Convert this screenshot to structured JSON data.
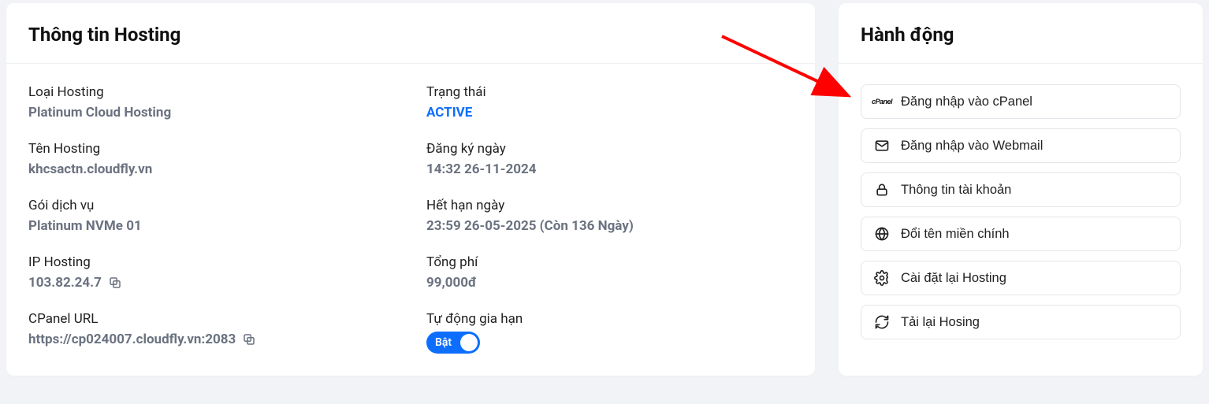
{
  "info_card": {
    "title": "Thông tin Hosting",
    "left": {
      "hosting_type_label": "Loại Hosting",
      "hosting_type_value": "Platinum Cloud Hosting",
      "hosting_name_label": "Tên Hosting",
      "hosting_name_value": "khcsactn.cloudfly.vn",
      "plan_label": "Gói dịch vụ",
      "plan_value": "Platinum NVMe 01",
      "ip_label": "IP Hosting",
      "ip_value": "103.82.24.7",
      "cpanel_url_label": "CPanel URL",
      "cpanel_url_value": "https://cp024007.cloudfly.vn:2083"
    },
    "right": {
      "status_label": "Trạng thái",
      "status_value": "ACTIVE",
      "reg_date_label": "Đăng ký ngày",
      "reg_date_value": "14:32 26-11-2024",
      "exp_date_label": "Hết hạn ngày",
      "exp_date_prefix": "23:59 26-05-2025 (Còn ",
      "exp_date_days": "136",
      "exp_date_suffix": " Ngày)",
      "total_label": "Tổng phí",
      "total_value": "99,000đ",
      "autorenew_label": "Tự động gia hạn",
      "autorenew_on": "Bật"
    }
  },
  "actions_card": {
    "title": "Hành động",
    "items": [
      {
        "label": "Đăng nhập vào cPanel"
      },
      {
        "label": "Đăng nhập vào Webmail"
      },
      {
        "label": "Thông tin tài khoản"
      },
      {
        "label": "Đổi tên miền chính"
      },
      {
        "label": "Cài đặt lại Hosting"
      },
      {
        "label": "Tải lại Hosing"
      }
    ]
  }
}
